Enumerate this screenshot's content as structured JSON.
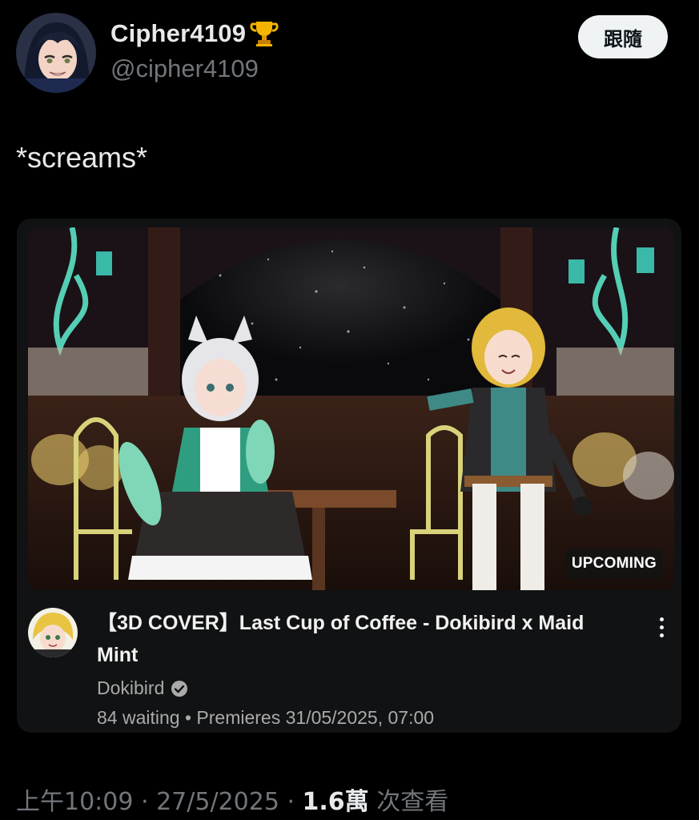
{
  "user": {
    "display_name": "Cipher4109",
    "badge_icon": "trophy-icon",
    "handle": "@cipher4109",
    "avatar": "anime-avatar"
  },
  "follow_button": {
    "label": "跟隨"
  },
  "tweet": {
    "text": "*screams*"
  },
  "card": {
    "badge": "UPCOMING",
    "video_title": "【3D COVER】Last Cup of Coffee - Dokibird x Maid Mint",
    "channel_name": "Dokibird",
    "verified_icon": "verified-check-icon",
    "waiting": "84 waiting",
    "separator": " • ",
    "premiere": "Premieres 31/05/2025, 07:00"
  },
  "footer": {
    "time": "上午10:09",
    "dot": " · ",
    "date": "27/5/2025",
    "views_count": "1.6萬",
    "views_label": " 次查看"
  },
  "colors": {
    "background": "#000000",
    "card_bg": "#111213",
    "muted": "#71767b",
    "follow_bg": "#eff3f4"
  }
}
